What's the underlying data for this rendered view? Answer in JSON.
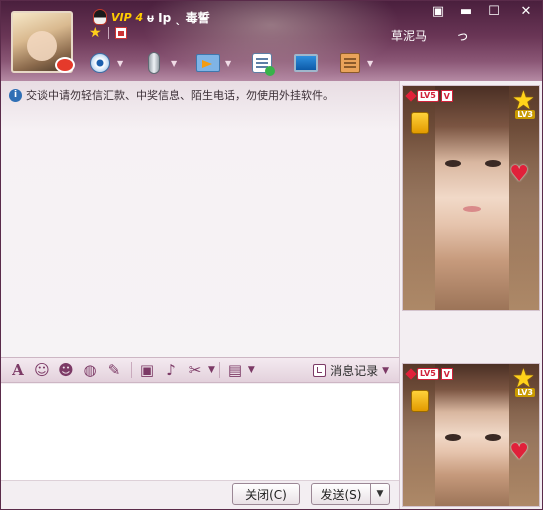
{
  "window": {
    "nickname": "ᵾ Ip ˎ 毒誓",
    "vip_label": "VIP 4",
    "status_name": "草泥马",
    "status_mark": "っ",
    "controls": {
      "menu": "▣",
      "minimize": "▬",
      "maximize": "☐",
      "close": "✕"
    }
  },
  "toolbar": {
    "items": [
      {
        "name": "video-call",
        "icon": "webcam-icon"
      },
      {
        "name": "voice-call",
        "icon": "microphone-icon"
      },
      {
        "name": "send-file",
        "icon": "folder-arrow-icon"
      },
      {
        "name": "create-discussion",
        "icon": "list-add-icon"
      },
      {
        "name": "remote-assist",
        "icon": "screen-icon"
      },
      {
        "name": "apps",
        "icon": "app-box-icon"
      }
    ],
    "dropdown_glyph": "▼"
  },
  "chat": {
    "notice": "交谈中请勿轻信汇款、中奖信息、陌生电话，勿使用外挂软件。",
    "info_glyph": "i"
  },
  "format_bar": {
    "font_glyph": "A",
    "emoji_glyph": "☺",
    "face_glyph": "☻",
    "gif_glyph": "◍",
    "edit_glyph": "✎",
    "image_glyph": "▣",
    "music_glyph": "♪",
    "cut_glyph": "✂",
    "gift_glyph": "▤",
    "history_label": "消息记录",
    "dropdown_glyph": "▼"
  },
  "buttons": {
    "close_label": "关闭(C)",
    "send_label": "发送(S)",
    "send_dropdown": "▼"
  },
  "side": {
    "level_tag": "LV5",
    "v_tag": "V",
    "lv3_tag": "LV3",
    "star_glyph": "★",
    "heart_glyph": "♥"
  }
}
